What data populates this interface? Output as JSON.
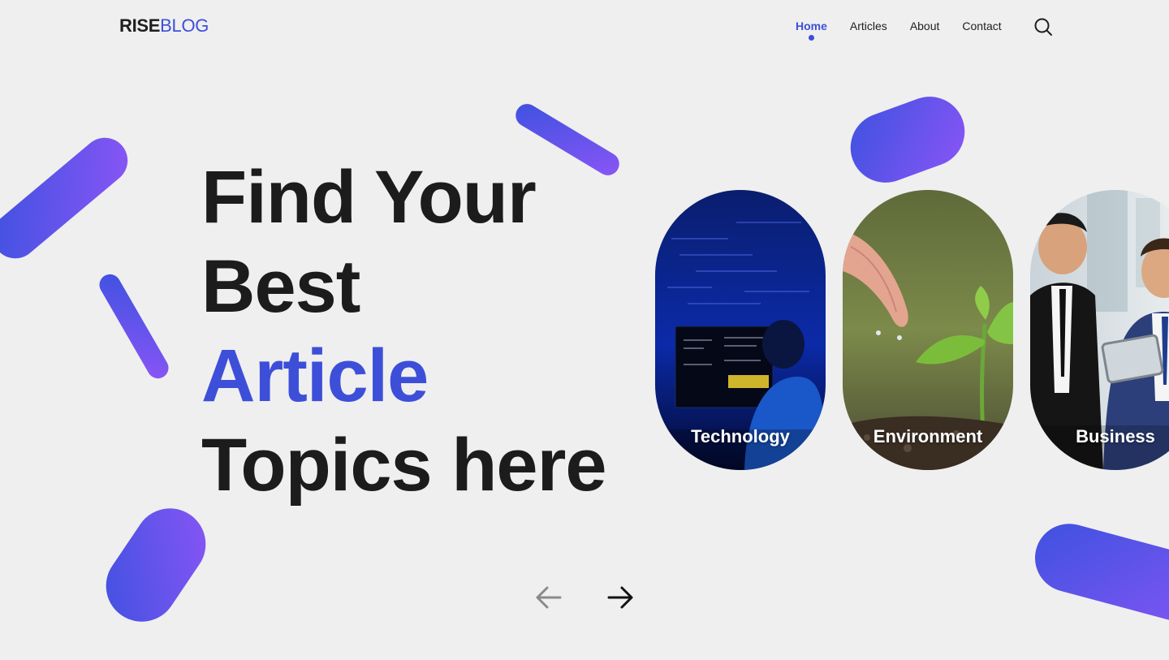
{
  "logo": {
    "part1": "RISE",
    "part2": "BLOG"
  },
  "nav": {
    "items": [
      {
        "label": "Home",
        "active": true
      },
      {
        "label": "Articles",
        "active": false
      },
      {
        "label": "About",
        "active": false
      },
      {
        "label": "Contact",
        "active": false
      }
    ],
    "search_icon": "search-icon"
  },
  "hero": {
    "line1": "Find Your",
    "line2": "Best",
    "line3": "Article",
    "line4": "Topics here"
  },
  "categories": [
    {
      "label": "Technology"
    },
    {
      "label": "Environment"
    },
    {
      "label": "Business"
    }
  ],
  "carousel": {
    "prev_icon": "arrow-left-icon",
    "next_icon": "arrow-right-icon"
  },
  "colors": {
    "accent": "#3d4fd9",
    "gradient_start": "#3e52e0",
    "gradient_end": "#8a55f6",
    "background": "#efefef",
    "text": "#1f1f1f"
  }
}
